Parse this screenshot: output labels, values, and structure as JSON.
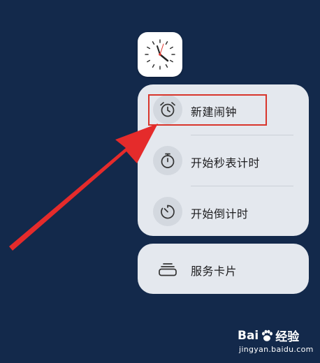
{
  "menu": {
    "items": [
      {
        "label": "新建闹钟",
        "icon": "alarm-clock-icon"
      },
      {
        "label": "开始秒表计时",
        "icon": "stopwatch-icon"
      },
      {
        "label": "开始倒计时",
        "icon": "timer-icon"
      }
    ]
  },
  "widget_card": {
    "label": "服务卡片",
    "icon": "card-stack-icon"
  },
  "watermark": {
    "brand_text": "Bai",
    "brand_text_2": "经验",
    "url": "jingyan.baidu.com"
  },
  "colors": {
    "background": "#13294b",
    "card": "#e4e8ee",
    "highlight": "#d8352b",
    "arrow": "#e52b2b"
  }
}
